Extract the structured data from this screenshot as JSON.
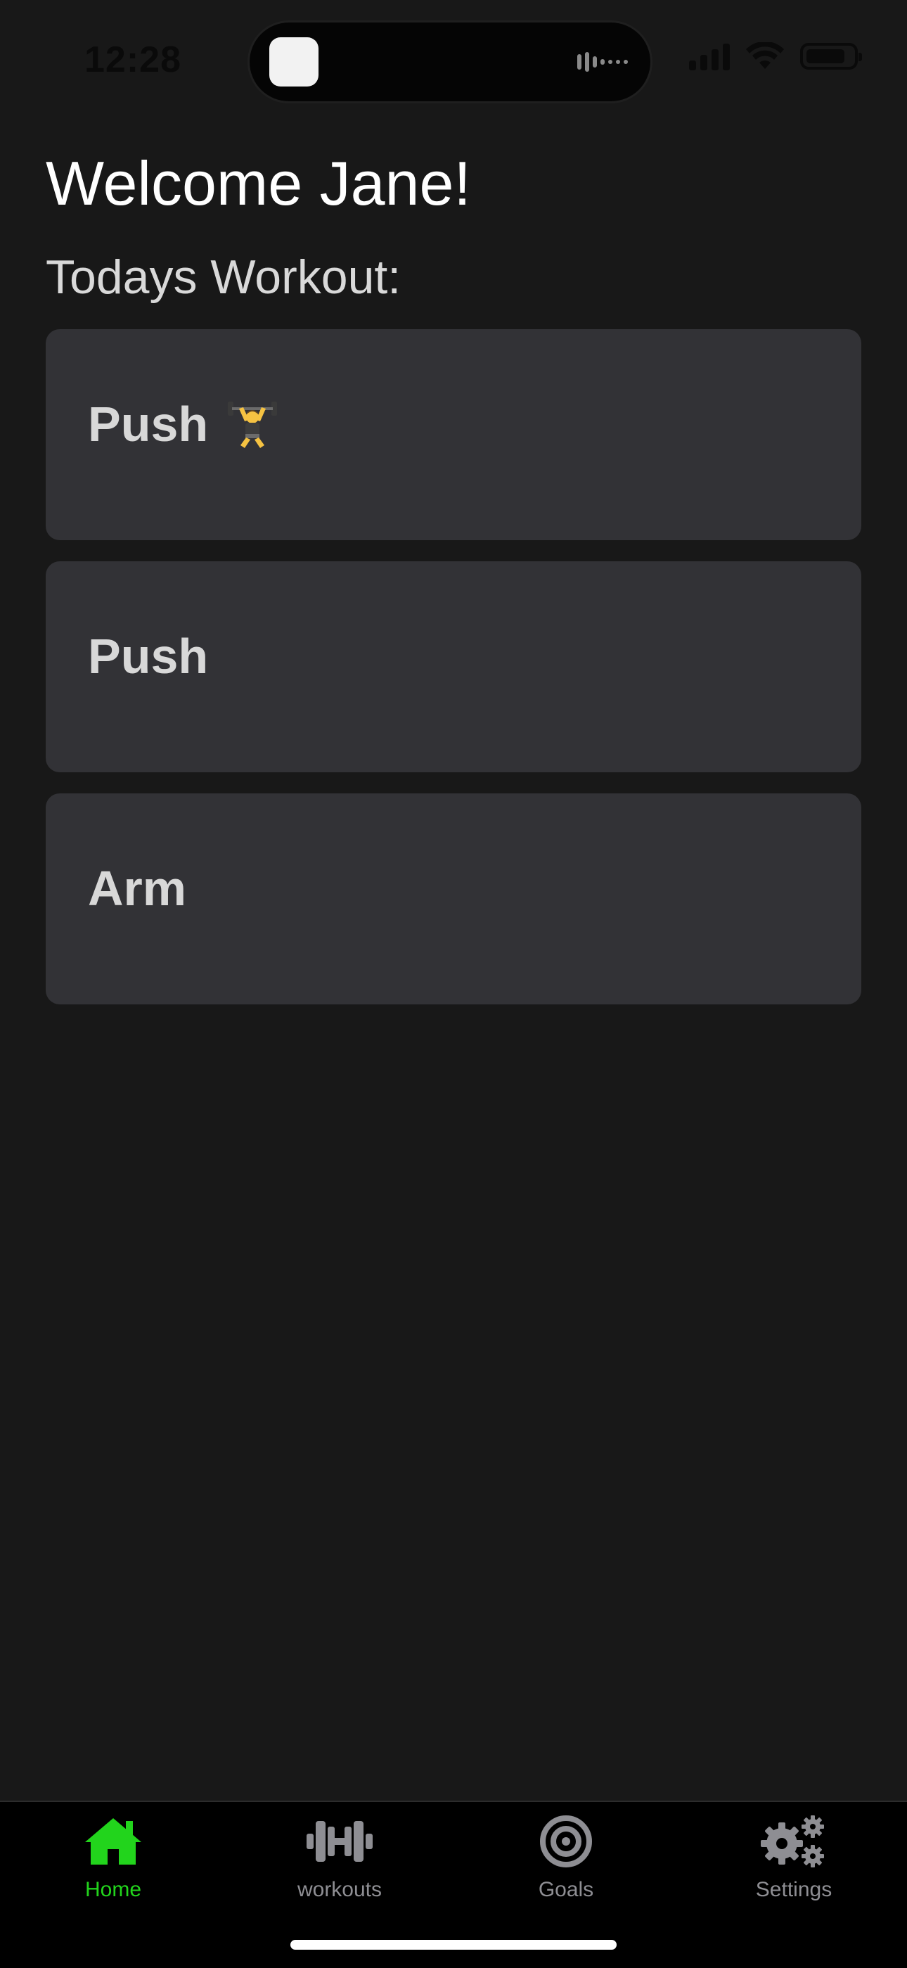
{
  "status_bar": {
    "time": "12:28"
  },
  "main": {
    "welcome": "Welcome Jane!",
    "subtitle": "Todays Workout:",
    "workouts": [
      {
        "label": "Push",
        "icon": "weightlifter-emoji"
      },
      {
        "label": "Push"
      },
      {
        "label": "Arm"
      }
    ]
  },
  "tab_bar": {
    "tabs": [
      {
        "label": "Home",
        "icon": "home-icon",
        "active": true
      },
      {
        "label": "workouts",
        "icon": "dumbbell-icon",
        "active": false
      },
      {
        "label": "Goals",
        "icon": "target-icon",
        "active": false
      },
      {
        "label": "Settings",
        "icon": "gears-icon",
        "active": false
      }
    ]
  },
  "colors": {
    "background": "#181818",
    "card": "#323236",
    "accent_active": "#22d41c",
    "tab_inactive": "#8e8e93"
  }
}
